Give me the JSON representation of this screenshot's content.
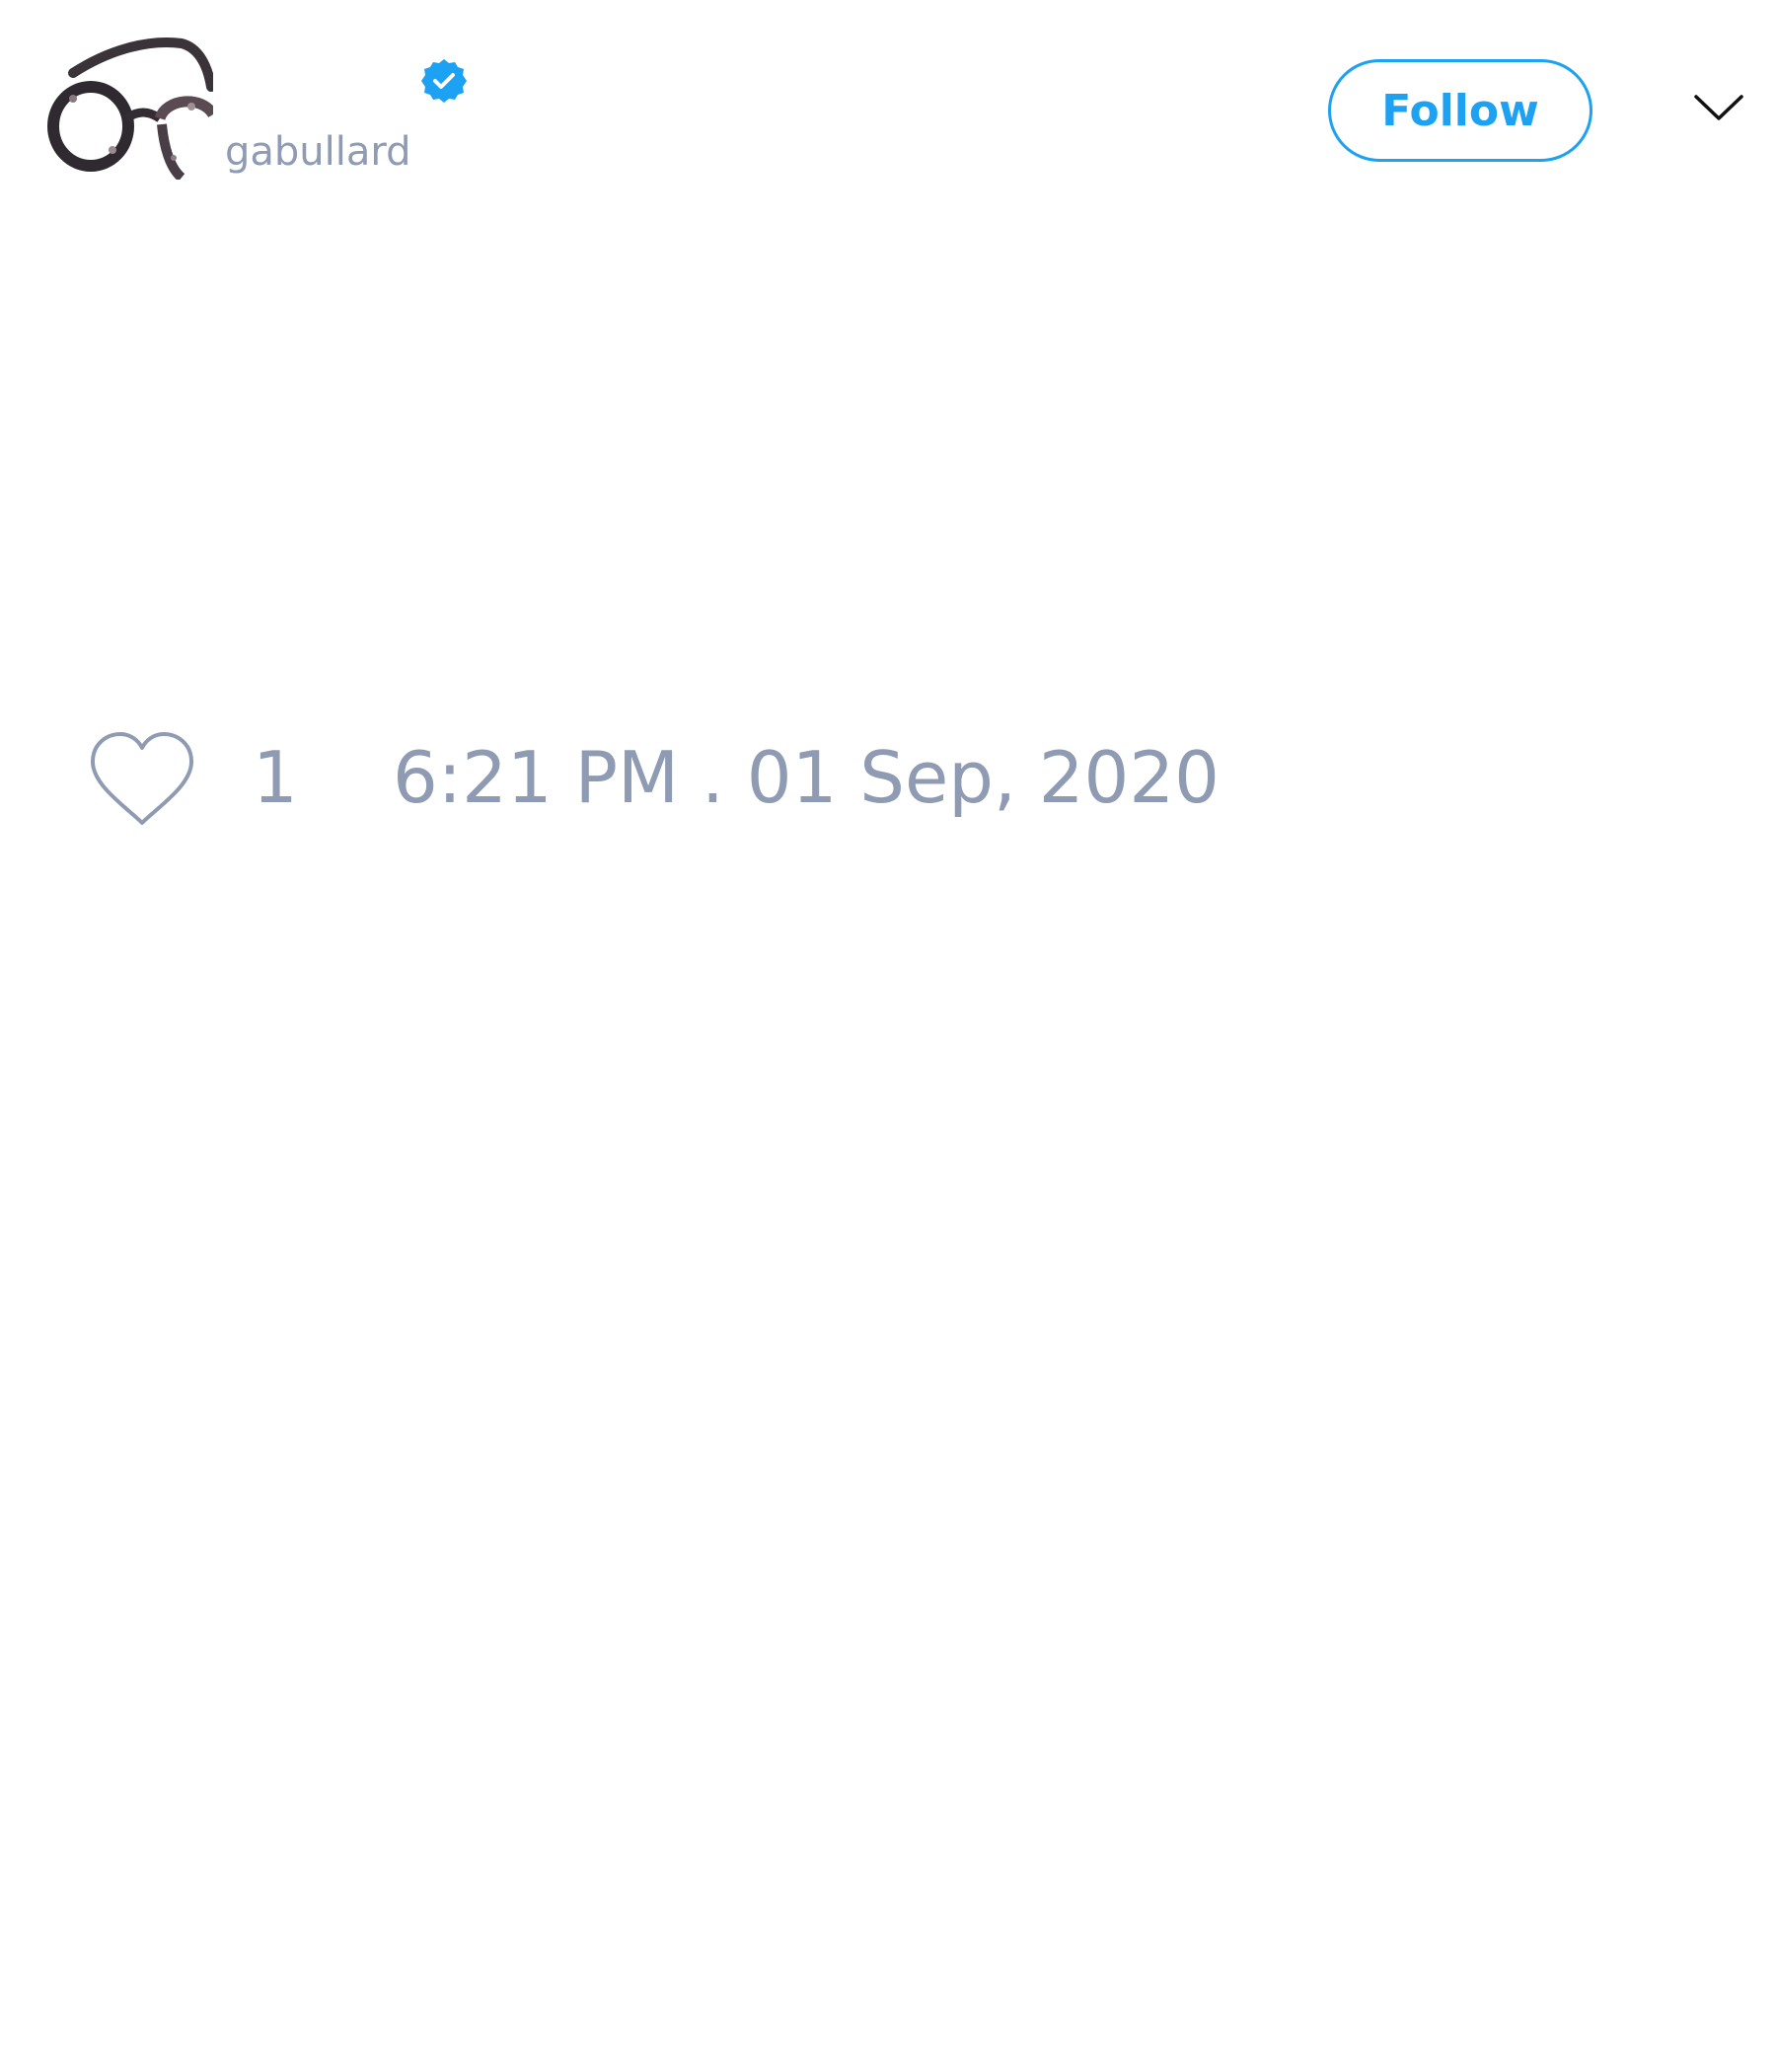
{
  "author": {
    "handle": "gabullard",
    "verified": true,
    "avatar_description": "glasses-avatar"
  },
  "actions": {
    "follow_label": "Follow"
  },
  "stats": {
    "like_count": "1",
    "timestamp": "6:21 PM . 01 Sep, 2020"
  },
  "icons": {
    "verified": "verified-badge-icon",
    "menu": "chevron-down-icon",
    "like": "heart-icon"
  },
  "colors": {
    "accent": "#1da1f2",
    "muted_text": "#8f9bb3",
    "background": "#ffffff"
  }
}
